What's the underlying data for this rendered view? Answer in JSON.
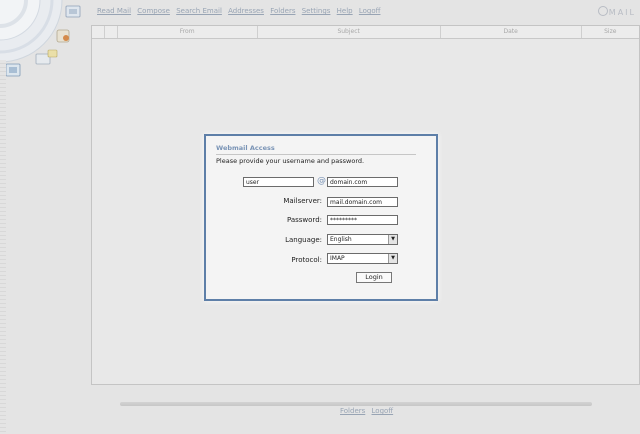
{
  "nav": {
    "items": [
      "Read Mail",
      "Compose",
      "Search Email",
      "Addresses",
      "Folders",
      "Settings",
      "Help",
      "Logoff"
    ],
    "brand": "MAIL"
  },
  "list": {
    "columns": [
      "",
      "",
      "From",
      "Subject",
      "Date",
      "Size"
    ]
  },
  "dialog": {
    "title": "Webmail Access",
    "prompt": "Please provide your username and password.",
    "username_value": "user",
    "at_sign": "@",
    "domain_value": "domain.com",
    "mailserver_label": "Mailserver:",
    "mailserver_value": "mail.domain.com",
    "password_label": "Password:",
    "password_value": "*********",
    "language_label": "Language:",
    "language_value": "English",
    "protocol_label": "Protocol:",
    "protocol_value": "IMAP",
    "login_label": "Login"
  },
  "footer": {
    "links": [
      "Folders",
      "Logoff"
    ]
  },
  "colors": {
    "accent": "#5e7fa8",
    "link": "#98a4b4",
    "background": "#e4e4e4"
  }
}
